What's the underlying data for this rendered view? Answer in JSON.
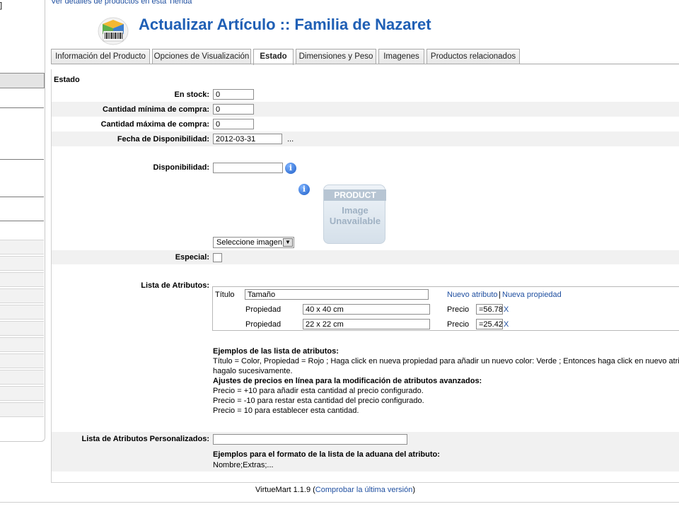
{
  "top_link": "Ver detalles de productos en esta Tienda",
  "sidebar": {
    "bracket": "]"
  },
  "header": {
    "title": "Actualizar Artículo :: Familia de Nazaret"
  },
  "tabs": [
    {
      "label": "Información del Producto",
      "active": false
    },
    {
      "label": "Opciones de Visualización",
      "active": false
    },
    {
      "label": "Estado",
      "active": true
    },
    {
      "label": "Dimensiones y Peso",
      "active": false
    },
    {
      "label": "Imagenes",
      "active": false
    },
    {
      "label": "Productos relacionados",
      "active": false
    }
  ],
  "section_title": "Estado",
  "fields": {
    "en_stock": {
      "label": "En stock:",
      "value": "0"
    },
    "min_compra": {
      "label": "Cantidad mínima de compra:",
      "value": "0"
    },
    "max_compra": {
      "label": "Cantidad máxima de compra:",
      "value": "0"
    },
    "fecha": {
      "label": "Fecha de Disponibilidad:",
      "value": "2012-03-31",
      "button": "..."
    },
    "disponibilidad": {
      "label": "Disponibilidad:",
      "value": ""
    },
    "especial": {
      "label": "Especial:",
      "checked": false
    }
  },
  "product_image": {
    "line1": "PRODUCT",
    "line2": "Image",
    "line3": "Unavailable"
  },
  "select_image": {
    "selected": "Seleccione imagen"
  },
  "attributes": {
    "label": "Lista de Atributos:",
    "titulo_label": "Título",
    "titulo_value": "Tamaño",
    "new_attr": "Nuevo atributo",
    "separator": "|",
    "new_prop": "Nueva propiedad",
    "rows": [
      {
        "prop_label": "Propiedad",
        "prop_value": "40 x 40 cm",
        "price_label": "Precio",
        "price_value": "=56.78",
        "delete": "X"
      },
      {
        "prop_label": "Propiedad",
        "prop_value": "22 x 22 cm",
        "price_label": "Precio",
        "price_value": "=25.42",
        "delete": "X"
      }
    ]
  },
  "examples": {
    "heading1": "Ejemplos de las lista de atributos:",
    "line1": "Título = Color, Propiedad = Rojo ; Haga click en nueva propiedad para añadir un nuevo color: Verde ; Entonces haga click en nuevo atribut",
    "line2": "hagalo sucesivamente.",
    "heading2": "Ajustes de precios en línea para la modificación de atributos avanzados:",
    "line3": "Precio = +10 para añadir esta cantidad al precio configurado.",
    "line4": "Precio = -10 para restar esta cantidad del precio configurado.",
    "line5": "Precio = 10 para establecer esta cantidad."
  },
  "custom_attrs": {
    "label": "Lista de Atributos Personalizados:",
    "value": "",
    "heading": "Ejemplos para el formato de la lista de la aduana del atributo:",
    "example": "Nombre;Extras;..."
  },
  "footer": {
    "version": "VirtueMart 1.1.9",
    "open": "(",
    "link": "Comprobar la última versión",
    "close": ")"
  },
  "colors": {
    "title": "#1f5fb5",
    "link": "#1f4fa0",
    "row_shade": "#f1f1f1"
  },
  "icons": {
    "logo": "barcode-box-icon",
    "info": "info-icon",
    "dropdown": "chevron-down-icon"
  }
}
